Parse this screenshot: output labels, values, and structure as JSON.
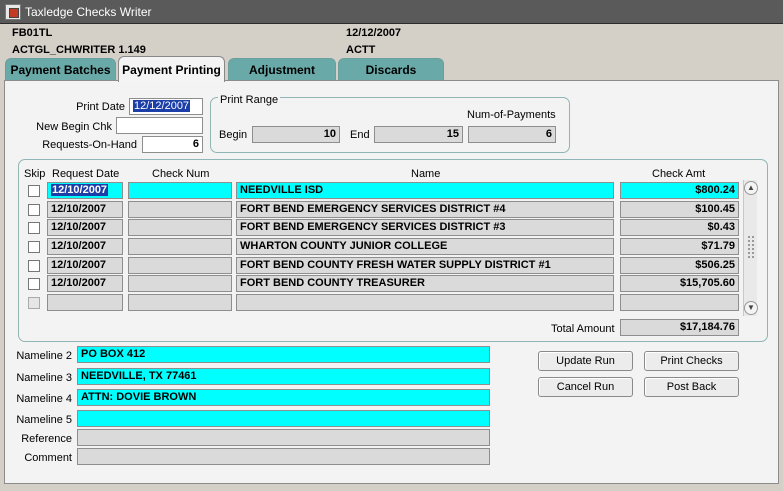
{
  "window": {
    "title": "Taxledge Checks Writer"
  },
  "header": {
    "code1": "FB01TL",
    "date": "12/12/2007",
    "module": "ACTGL_CHWRITER 1.149",
    "user": "ACTT"
  },
  "tabs": [
    "Payment Batches",
    "Payment Printing",
    "Adjustment",
    "Discards"
  ],
  "form": {
    "print_date_label": "Print Date",
    "print_date": "12/12/2007",
    "new_begin_chk_label": "New Begin Chk",
    "new_begin_chk": "",
    "requests_on_hand_label": "Requests-On-Hand",
    "requests_on_hand": "6"
  },
  "print_range": {
    "label": "Print Range",
    "begin_label": "Begin",
    "begin": "10",
    "end_label": "End",
    "end": "15",
    "num_payments_label": "Num-of-Payments",
    "num_payments": "6"
  },
  "table": {
    "headers": {
      "skip": "Skip",
      "request_date": "Request Date",
      "check_num": "Check Num",
      "name": "Name",
      "check_amt": "Check Amt"
    },
    "rows": [
      {
        "date": "12/10/2007",
        "check_num": "",
        "name": "NEEDVILLE ISD",
        "amount": "$800.24"
      },
      {
        "date": "12/10/2007",
        "check_num": "",
        "name": "FORT BEND EMERGENCY SERVICES DISTRICT #4",
        "amount": "$100.45"
      },
      {
        "date": "12/10/2007",
        "check_num": "",
        "name": "FORT BEND EMERGENCY SERVICES DISTRICT #3",
        "amount": "$0.43"
      },
      {
        "date": "12/10/2007",
        "check_num": "",
        "name": "WHARTON COUNTY JUNIOR COLLEGE",
        "amount": "$71.79"
      },
      {
        "date": "12/10/2007",
        "check_num": "",
        "name": "FORT BEND COUNTY FRESH WATER SUPPLY DISTRICT #1",
        "amount": "$506.25"
      },
      {
        "date": "12/10/2007",
        "check_num": "",
        "name": "FORT BEND COUNTY TREASURER",
        "amount": "$15,705.60"
      },
      {
        "date": "",
        "check_num": "",
        "name": "",
        "amount": ""
      }
    ],
    "total_label": "Total Amount",
    "total": "$17,184.76"
  },
  "details": {
    "nameline2_label": "Nameline 2",
    "nameline2": "PO BOX 412",
    "nameline3_label": "Nameline 3",
    "nameline3": "NEEDVILLE, TX  77461",
    "nameline4_label": "Nameline 4",
    "nameline4": "ATTN:  DOVIE BROWN",
    "nameline5_label": "Nameline 5",
    "nameline5": "",
    "reference_label": "Reference",
    "reference": "",
    "comment_label": "Comment",
    "comment": ""
  },
  "buttons": {
    "update_run": "Update Run",
    "print_checks": "Print Checks",
    "cancel_run": "Cancel Run",
    "post_back": "Post Back"
  },
  "colors": {
    "active_field": "#00ffff",
    "tab": "#69aaa9",
    "selection": "#1c3ea8"
  }
}
